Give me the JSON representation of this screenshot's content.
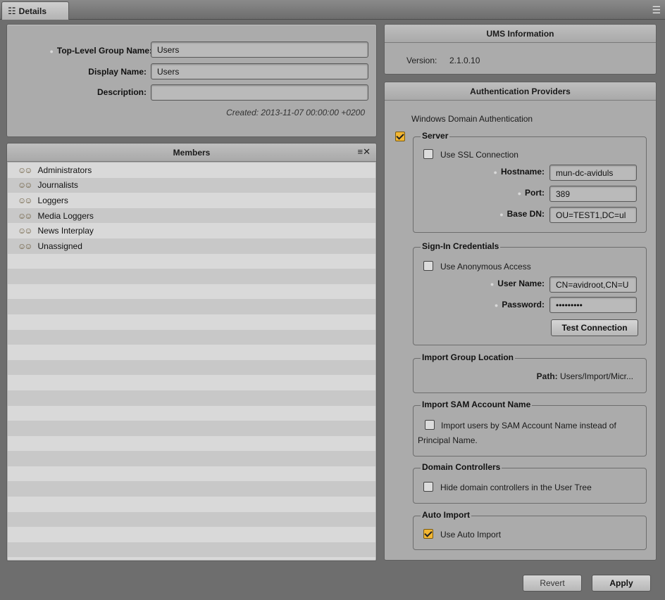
{
  "tab": {
    "label": "Details",
    "icon": "list-icon"
  },
  "group_details": {
    "top_level_label": "Top-Level Group Name:",
    "top_level_value": "Users",
    "display_label": "Display Name:",
    "display_value": "Users",
    "description_label": "Description:",
    "description_value": "",
    "created": "Created:  2013-11-07 00:00:00 +0200"
  },
  "members": {
    "title": "Members",
    "items": [
      "Administrators",
      "Journalists",
      "Loggers",
      "Media Loggers",
      "News Interplay",
      "Unassigned"
    ]
  },
  "ums": {
    "title": "UMS Information",
    "version_label": "Version:",
    "version_value": "2.1.0.10"
  },
  "auth": {
    "title": "Authentication Providers",
    "windows_domain": "Windows Domain Authentication",
    "server": {
      "title": "Server",
      "use_ssl": "Use SSL Connection",
      "hostname_label": "Hostname:",
      "hostname_value": "mun-dc-aviduls",
      "port_label": "Port:",
      "port_value": "389",
      "basedn_label": "Base DN:",
      "basedn_value": "OU=TEST1,DC=ul"
    },
    "credentials": {
      "title": "Sign-In Credentials",
      "anonymous": "Use Anonymous Access",
      "username_label": "User Name:",
      "username_value": "CN=avidroot,CN=U",
      "password_label": "Password:",
      "password_value": "•••••••••",
      "test_button": "Test Connection"
    },
    "import_group": {
      "title": "Import Group Location",
      "path_label": "Path:",
      "path_value": "Users/Import/Micr..."
    },
    "sam": {
      "title": "Import SAM Account Name",
      "option_line1": "Import users by SAM Account Name instead of",
      "option_line2": "Principal Name."
    },
    "domain_controllers": {
      "title": "Domain Controllers",
      "option": "Hide domain controllers in the User Tree"
    },
    "auto_import": {
      "title": "Auto Import",
      "option": "Use Auto Import"
    }
  },
  "footer": {
    "revert": "Revert",
    "apply": "Apply"
  },
  "colors": {
    "accent_check": "#f2b632",
    "panel": "#ababab",
    "background": "#6e6e6e"
  }
}
